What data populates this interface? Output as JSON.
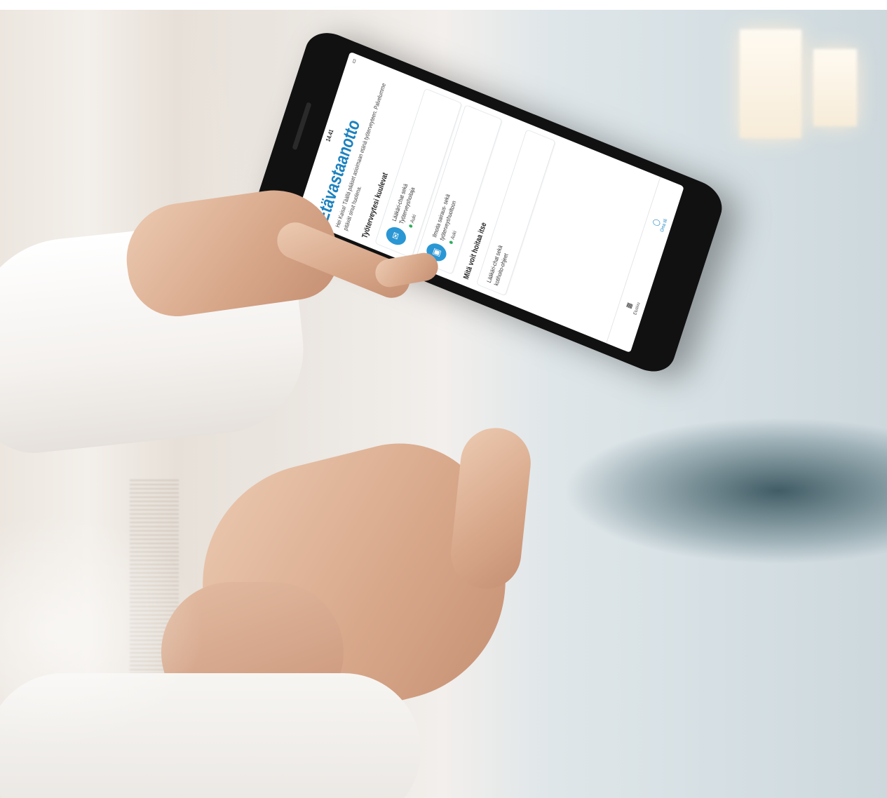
{
  "phone": {
    "status_bar": {
      "time": "14.41"
    },
    "app_title": "Etävastaanotto",
    "intro_text": "Hei Kaisa! Täällä pääset asioimaan etänä työterveyteen. Palvelumme pitävät sinut huolena.",
    "section_occupational": "Työterveytesi kuulevat",
    "cards": [
      {
        "icon": "chat-icon",
        "line1": "Lääkäri-chat sekä",
        "line2": "Työterveyshoitaja",
        "status": "Auki"
      },
      {
        "icon": "video-icon",
        "line1": "Ilmoita sairaus- sekä",
        "line2": "työterveyshuoltoon",
        "status": "Auki"
      }
    ],
    "section_self": "Mitä voit hoitaa itse",
    "self_card": {
      "line1": "Lääkäri-chat sekä",
      "line2": "kotihoito-ohjeet"
    },
    "tabs": [
      {
        "label": "Etusivu",
        "icon": "grid-icon"
      },
      {
        "label": "Oma tili",
        "icon": "user-icon"
      }
    ],
    "colors": {
      "accent": "#1c82bf",
      "card_icon": "#2a97d4",
      "status_green": "#2fae5b"
    }
  }
}
